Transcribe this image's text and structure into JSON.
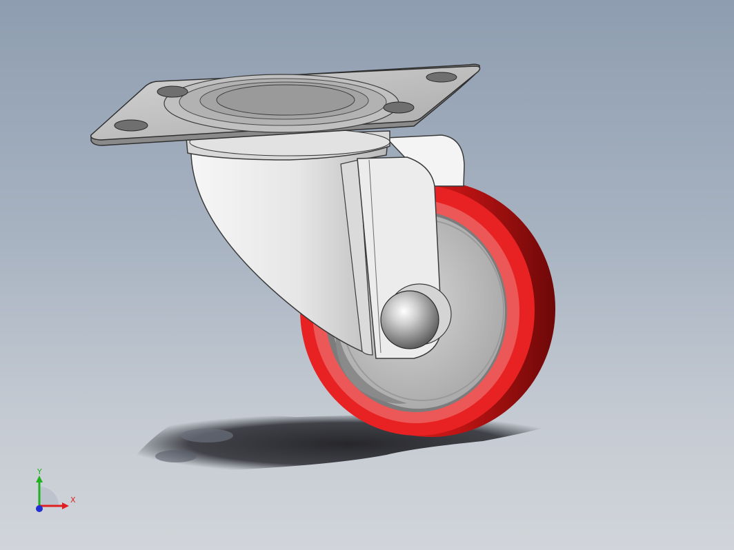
{
  "viewport": {
    "background_top": "#8e9db0",
    "background_bottom": "#d1d5da"
  },
  "model": {
    "wheel_tread_color": "#e41e1e",
    "wheel_tread_dark": "#8e0c0c",
    "hub_color": "#c8c8c8",
    "bracket_color": "#e4e4e4",
    "plate_color": "#bfbfbf"
  },
  "triad": {
    "x_label": "X",
    "y_label": "Y",
    "x_color": "#e02020",
    "y_color": "#20b020",
    "z_color": "#2030d0"
  }
}
